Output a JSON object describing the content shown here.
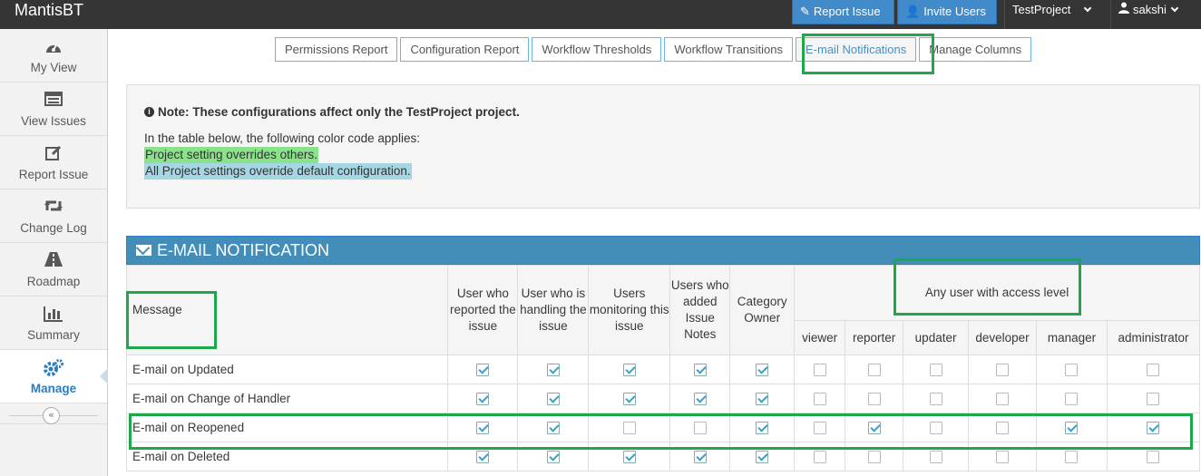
{
  "navbar": {
    "brand": "MantisBT",
    "report_issue": "Report Issue",
    "invite_users": "Invite Users",
    "project": "TestProject",
    "user": "sakshi"
  },
  "sidebar": {
    "items": [
      {
        "label": "My View",
        "icon": "dashboard-icon"
      },
      {
        "label": "View Issues",
        "icon": "list-icon"
      },
      {
        "label": "Report Issue",
        "icon": "edit-icon"
      },
      {
        "label": "Change Log",
        "icon": "retweet-icon"
      },
      {
        "label": "Roadmap",
        "icon": "road-icon"
      },
      {
        "label": "Summary",
        "icon": "bar-chart-icon"
      },
      {
        "label": "Manage",
        "icon": "gears-icon",
        "active": true
      }
    ],
    "collapse_glyph": "«"
  },
  "tabs": [
    {
      "label": "Permissions Report"
    },
    {
      "label": "Configuration Report"
    },
    {
      "label": "Workflow Thresholds"
    },
    {
      "label": "Workflow Transitions"
    },
    {
      "label": "E-mail Notifications",
      "active": true
    },
    {
      "label": "Manage Columns"
    }
  ],
  "note": {
    "title": "Note: These configurations affect only the TestProject project.",
    "intro": "In the table below, the following color code applies:",
    "legend_project": "Project setting overrides others.",
    "legend_all": "All Project settings override default configuration.",
    "colors": {
      "project": "#8ae38a",
      "all": "#a5d6e3"
    }
  },
  "widget": {
    "title": "E-MAIL NOTIFICATION"
  },
  "table": {
    "message_header": "Message",
    "role_headers": [
      "User who reported the issue",
      "User who is handling the issue",
      "Users monitoring this issue",
      "Users who added Issue Notes",
      "Category Owner"
    ],
    "access_group_header": "Any user with access level",
    "access_levels": [
      "viewer",
      "reporter",
      "updater",
      "developer",
      "manager",
      "administrator"
    ],
    "rows": [
      {
        "message": "E-mail on Updated",
        "checks": [
          true,
          true,
          true,
          true,
          true,
          false,
          false,
          false,
          false,
          false,
          false
        ]
      },
      {
        "message": "E-mail on Change of Handler",
        "checks": [
          true,
          true,
          true,
          true,
          true,
          false,
          false,
          false,
          false,
          false,
          false
        ]
      },
      {
        "message": "E-mail on Reopened",
        "checks": [
          true,
          true,
          false,
          false,
          true,
          false,
          true,
          false,
          false,
          true,
          true
        ]
      },
      {
        "message": "E-mail on Deleted",
        "checks": [
          true,
          true,
          true,
          true,
          true,
          false,
          false,
          false,
          false,
          false,
          false
        ]
      }
    ]
  }
}
